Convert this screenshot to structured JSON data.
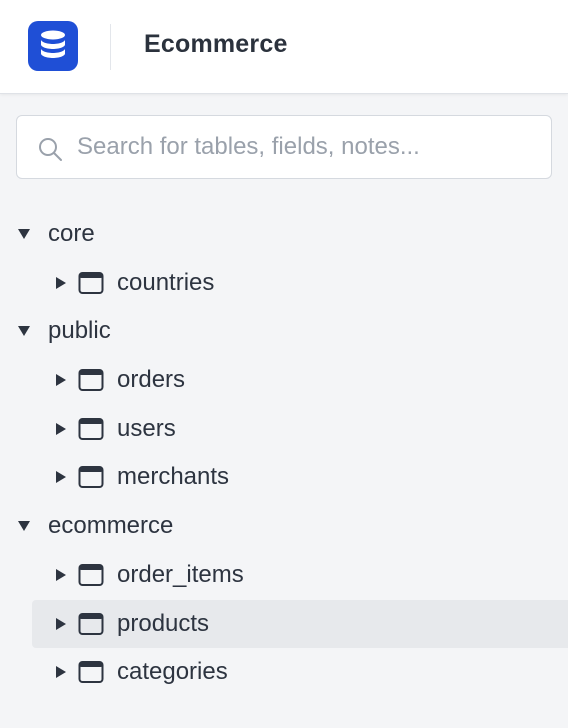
{
  "header": {
    "logo_icon": "database-icon",
    "title": "Ecommerce",
    "brand_color": "#1f4fd6"
  },
  "search": {
    "placeholder": "Search for tables, fields, notes...",
    "value": ""
  },
  "tree": {
    "schemas": [
      {
        "name": "core",
        "expanded": true,
        "tables": [
          {
            "name": "countries",
            "selected": false
          }
        ]
      },
      {
        "name": "public",
        "expanded": true,
        "tables": [
          {
            "name": "orders",
            "selected": false
          },
          {
            "name": "users",
            "selected": false
          },
          {
            "name": "merchants",
            "selected": false
          }
        ]
      },
      {
        "name": "ecommerce",
        "expanded": true,
        "tables": [
          {
            "name": "order_items",
            "selected": false
          },
          {
            "name": "products",
            "selected": true
          },
          {
            "name": "categories",
            "selected": false
          }
        ]
      }
    ]
  }
}
